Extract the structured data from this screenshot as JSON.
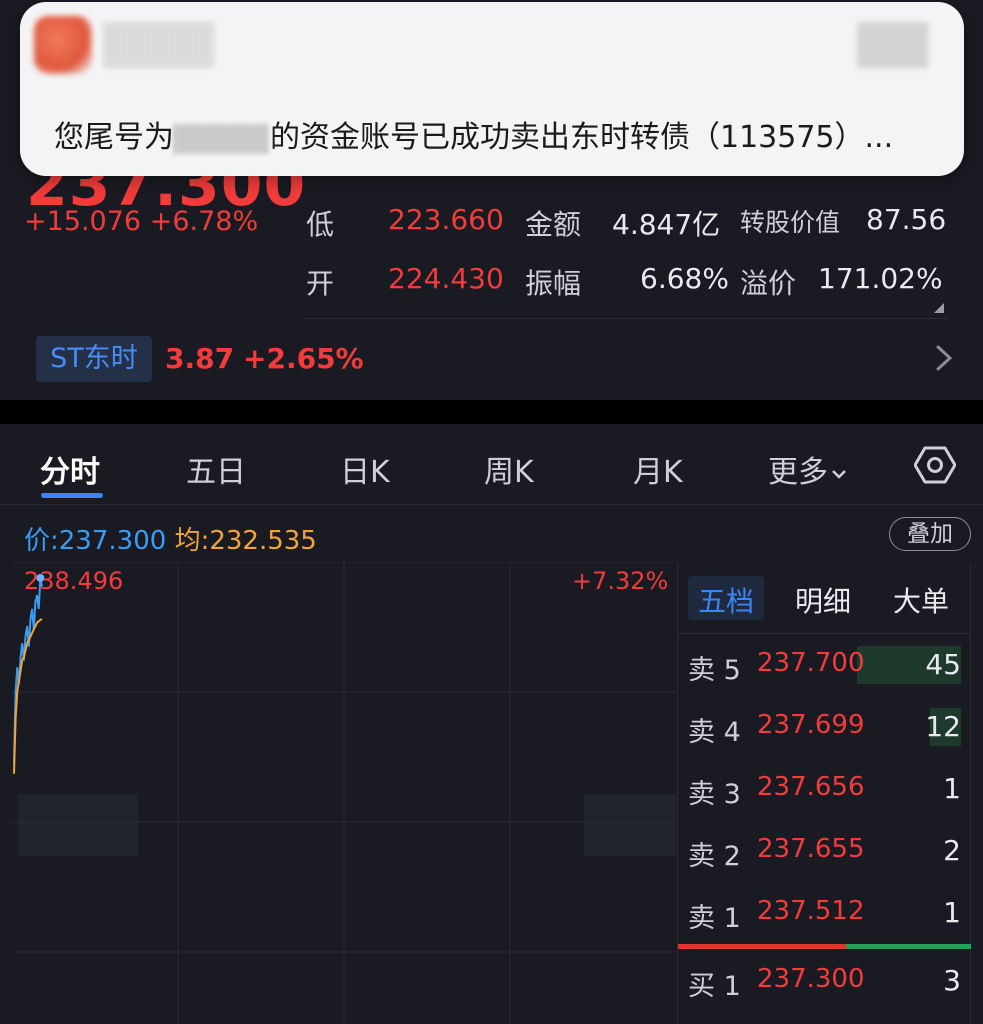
{
  "quote": {
    "price": "237.300",
    "change": "+15.076",
    "change_pct": "+6.78%",
    "low_label": "低",
    "low_value": "223.660",
    "amount_label": "金额",
    "amount_value": "4.847亿",
    "conv_value_label": "转股价值",
    "conv_value": "87.56",
    "open_label": "开",
    "open_value": "224.430",
    "amplitude_label": "振幅",
    "amplitude_value": "6.68%",
    "premium_label": "溢价",
    "premium_value": "171.02%"
  },
  "related_stock": {
    "name": "ST东时",
    "price": "3.87",
    "change_pct": "+2.65%"
  },
  "notification": {
    "message_prefix": "您尾号为",
    "message_suffix": "的资金账号已成功卖出东时转债（113575）..."
  },
  "tabs": [
    {
      "label": "分时",
      "active": true
    },
    {
      "label": "五日",
      "active": false
    },
    {
      "label": "日K",
      "active": false
    },
    {
      "label": "周K",
      "active": false
    },
    {
      "label": "月K",
      "active": false
    },
    {
      "label": "更多",
      "active": false
    }
  ],
  "price_info": {
    "price_label": "价:",
    "price_value": "237.300",
    "avg_label": "均:",
    "avg_value": "232.535",
    "overlay_label": "叠加"
  },
  "chart": {
    "high_label": "238.496",
    "pct_label": "+7.32%"
  },
  "chart_data": {
    "type": "line",
    "ylim": [
      205.9,
      238.496
    ],
    "series": [
      {
        "values": [
          211.5,
          222.0,
          225.5,
          223.0,
          227.0,
          229.0,
          226.5,
          230.0,
          231.5,
          228.5,
          232.5,
          234.0,
          231.0,
          235.0,
          236.0,
          234.0,
          238.5,
          237.3
        ]
      },
      {
        "values": [
          210.0,
          218.0,
          222.0,
          223.5,
          225.0,
          226.5,
          227.0,
          228.0,
          229.0,
          229.5,
          230.0,
          230.5,
          231.0,
          231.5,
          232.0,
          232.2,
          232.4,
          232.535
        ]
      }
    ],
    "colors": [
      "#3a9cf2",
      "#f2a33a"
    ]
  },
  "order_book": {
    "tabs": [
      "五档",
      "明细",
      "大单"
    ],
    "rows": [
      {
        "side": "卖 5",
        "price": "237.700",
        "volume": "45",
        "bar": 0.4
      },
      {
        "side": "卖 4",
        "price": "237.699",
        "volume": "12",
        "bar": 0.12
      },
      {
        "side": "卖 3",
        "price": "237.656",
        "volume": "1",
        "bar": 0
      },
      {
        "side": "卖 2",
        "price": "237.655",
        "volume": "2",
        "bar": 0
      },
      {
        "side": "卖 1",
        "price": "237.512",
        "volume": "1",
        "bar": 0
      },
      {
        "side": "买 1",
        "price": "237.300",
        "volume": "3",
        "bar": 0
      }
    ]
  }
}
